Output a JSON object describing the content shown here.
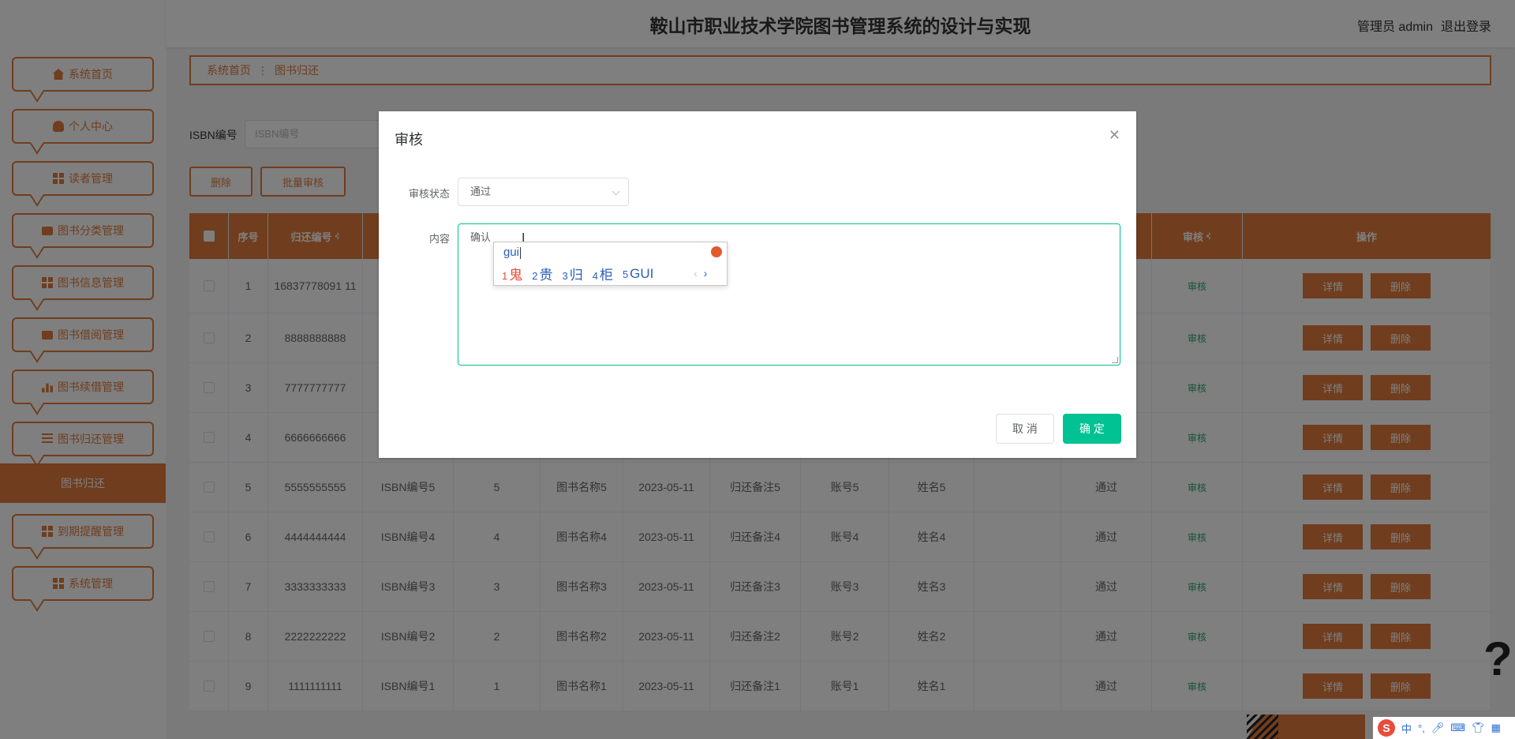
{
  "header": {
    "title": "鞍山市职业技术学院图书管理系统的设计与实现",
    "user": "管理员 admin",
    "logout": "退出登录"
  },
  "sidebar": {
    "items": [
      {
        "label": "系统首页",
        "icon": "home-icon"
      },
      {
        "label": "个人中心",
        "icon": "user-icon"
      },
      {
        "label": "读者管理",
        "icon": "grid-icon"
      },
      {
        "label": "图书分类管理",
        "icon": "monitor-icon"
      },
      {
        "label": "图书信息管理",
        "icon": "grid-icon"
      },
      {
        "label": "图书借阅管理",
        "icon": "chart-icon"
      },
      {
        "label": "图书续借管理",
        "icon": "bar-chart-icon"
      },
      {
        "label": "图书归还管理",
        "icon": "list-icon"
      },
      {
        "label": "到期提醒管理",
        "icon": "grid-icon"
      },
      {
        "label": "系统管理",
        "icon": "grid-icon"
      }
    ],
    "active_sub": "图书归还"
  },
  "breadcrumb": {
    "home": "系统首页",
    "current": "图书归还"
  },
  "search": {
    "label": "ISBN编号",
    "placeholder": "ISBN编号"
  },
  "toolbar": {
    "delete": "删除",
    "batch_audit": "批量审核"
  },
  "table": {
    "headers": [
      "序号",
      "归还编号",
      "",
      "",
      "",
      "",
      "",
      "",
      "",
      "",
      "",
      "审核",
      "操作"
    ],
    "rows": [
      {
        "idx": "1",
        "code": "16837778091 11",
        "isbn": "",
        "num": "",
        "name": "",
        "date": "",
        "note": "",
        "acct": "",
        "uname": "",
        "blank": "",
        "status": "",
        "audit": "审核"
      },
      {
        "idx": "2",
        "code": "8888888888",
        "isbn": "",
        "num": "",
        "name": "",
        "date": "",
        "note": "",
        "acct": "",
        "uname": "",
        "blank": "",
        "status": "",
        "audit": "审核"
      },
      {
        "idx": "3",
        "code": "7777777777",
        "isbn": "",
        "num": "",
        "name": "",
        "date": "",
        "note": "",
        "acct": "",
        "uname": "",
        "blank": "",
        "status": "",
        "audit": "审核"
      },
      {
        "idx": "4",
        "code": "6666666666",
        "isbn": "",
        "num": "",
        "name": "",
        "date": "",
        "note": "",
        "acct": "",
        "uname": "",
        "blank": "",
        "status": "",
        "audit": "审核"
      },
      {
        "idx": "5",
        "code": "5555555555",
        "isbn": "ISBN编号5",
        "num": "5",
        "name": "图书名称5",
        "date": "2023-05-11",
        "note": "归还备注5",
        "acct": "账号5",
        "uname": "姓名5",
        "blank": "",
        "status": "通过",
        "audit": "审核"
      },
      {
        "idx": "6",
        "code": "4444444444",
        "isbn": "ISBN编号4",
        "num": "4",
        "name": "图书名称4",
        "date": "2023-05-11",
        "note": "归还备注4",
        "acct": "账号4",
        "uname": "姓名4",
        "blank": "",
        "status": "通过",
        "audit": "审核"
      },
      {
        "idx": "7",
        "code": "3333333333",
        "isbn": "ISBN编号3",
        "num": "3",
        "name": "图书名称3",
        "date": "2023-05-11",
        "note": "归还备注3",
        "acct": "账号3",
        "uname": "姓名3",
        "blank": "",
        "status": "通过",
        "audit": "审核"
      },
      {
        "idx": "8",
        "code": "2222222222",
        "isbn": "ISBN编号2",
        "num": "2",
        "name": "图书名称2",
        "date": "2023-05-11",
        "note": "归还备注2",
        "acct": "账号2",
        "uname": "姓名2",
        "blank": "",
        "status": "通过",
        "audit": "审核"
      },
      {
        "idx": "9",
        "code": "1111111111",
        "isbn": "ISBN编号1",
        "num": "1",
        "name": "图书名称1",
        "date": "2023-05-11",
        "note": "归还备注1",
        "acct": "账号1",
        "uname": "姓名1",
        "blank": "",
        "status": "通过",
        "audit": "审核"
      }
    ],
    "actions": {
      "detail": "详情",
      "delete": "删除"
    }
  },
  "dialog": {
    "title": "审核",
    "status_label": "审核状态",
    "status_value": "通过",
    "content_label": "内容",
    "content_value": "确认",
    "cancel": "取 消",
    "confirm": "确 定"
  },
  "ime": {
    "composition": "gui",
    "candidates": [
      {
        "n": "1",
        "c": "鬼"
      },
      {
        "n": "2",
        "c": "贵"
      },
      {
        "n": "3",
        "c": "归"
      },
      {
        "n": "4",
        "c": "柜"
      },
      {
        "n": "5",
        "c": "GUI"
      }
    ],
    "prev": "‹",
    "next": "›"
  },
  "tray": {
    "logo": "S",
    "lang": "中",
    "punct": "°,"
  },
  "colors": {
    "accent": "#e07b3c",
    "confirm": "#00c292",
    "audit_link": "#2ba471"
  }
}
